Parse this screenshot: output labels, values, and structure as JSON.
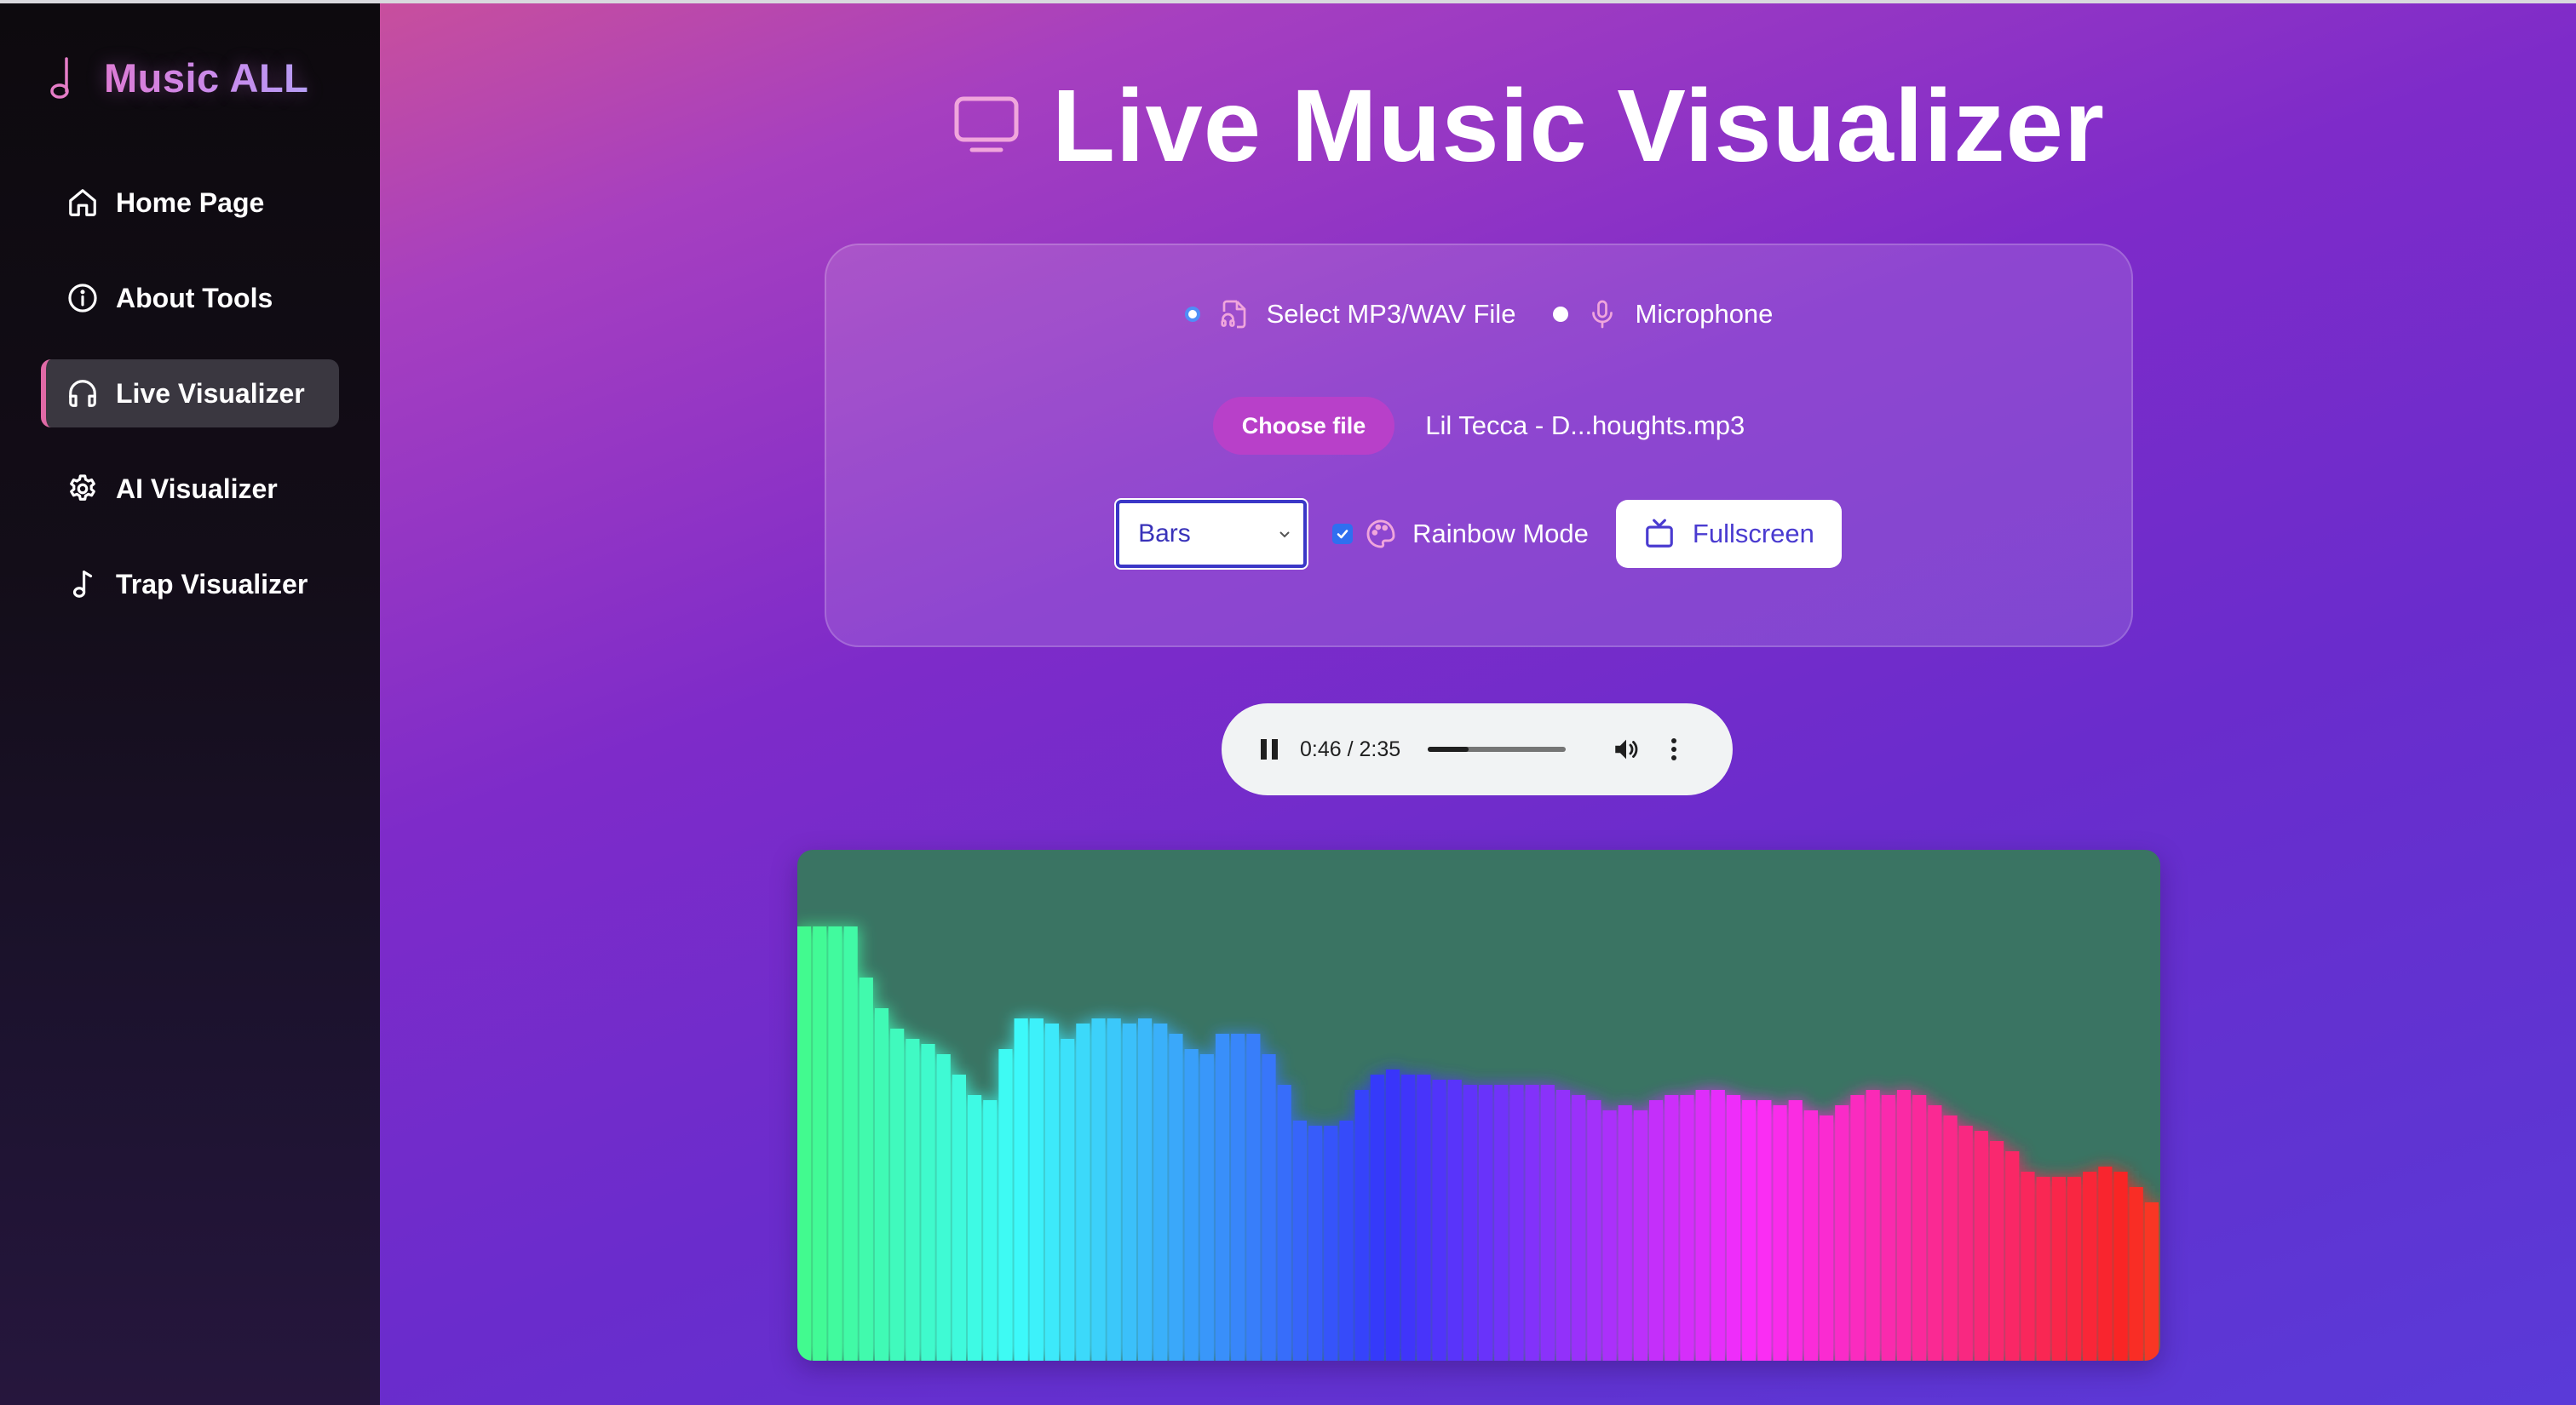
{
  "app": {
    "name": "Music ALL"
  },
  "sidebar": {
    "items": [
      {
        "label": "Home Page",
        "icon": "home-icon",
        "active": false
      },
      {
        "label": "About Tools",
        "icon": "info-icon",
        "active": false
      },
      {
        "label": "Live Visualizer",
        "icon": "headphones-icon",
        "active": true
      },
      {
        "label": "AI Visualizer",
        "icon": "gear-icon",
        "active": false
      },
      {
        "label": "Trap Visualizer",
        "icon": "music-note-icon",
        "active": false
      }
    ]
  },
  "main": {
    "title": "Live Music Visualizer",
    "title_icon": "monitor-icon"
  },
  "source": {
    "file_option_label": "Select MP3/WAV File",
    "mic_option_label": "Microphone",
    "selected": "file"
  },
  "file": {
    "button_label": "Choose file",
    "file_name": "Lil Tecca - D...houghts.mp3"
  },
  "controls": {
    "mode_selected": "Bars",
    "rainbow_label": "Rainbow Mode",
    "rainbow_checked": true,
    "fullscreen_label": "Fullscreen"
  },
  "player": {
    "time": "0:46 / 2:35",
    "progress": 0.297,
    "state": "playing"
  },
  "visualizer": {
    "background": "#3a7463",
    "bar_heights": [
      0.85,
      0.85,
      0.85,
      0.85,
      0.75,
      0.69,
      0.65,
      0.63,
      0.62,
      0.6,
      0.56,
      0.52,
      0.51,
      0.61,
      0.67,
      0.67,
      0.66,
      0.63,
      0.66,
      0.67,
      0.67,
      0.66,
      0.67,
      0.66,
      0.64,
      0.61,
      0.6,
      0.64,
      0.64,
      0.64,
      0.6,
      0.54,
      0.47,
      0.46,
      0.46,
      0.47,
      0.53,
      0.56,
      0.57,
      0.56,
      0.56,
      0.55,
      0.55,
      0.54,
      0.54,
      0.54,
      0.54,
      0.54,
      0.54,
      0.53,
      0.52,
      0.51,
      0.49,
      0.5,
      0.49,
      0.51,
      0.52,
      0.52,
      0.53,
      0.53,
      0.52,
      0.51,
      0.51,
      0.5,
      0.51,
      0.49,
      0.48,
      0.5,
      0.52,
      0.53,
      0.52,
      0.53,
      0.52,
      0.5,
      0.48,
      0.46,
      0.45,
      0.43,
      0.41,
      0.37,
      0.36,
      0.36,
      0.36,
      0.37,
      0.38,
      0.37,
      0.34,
      0.31
    ]
  }
}
